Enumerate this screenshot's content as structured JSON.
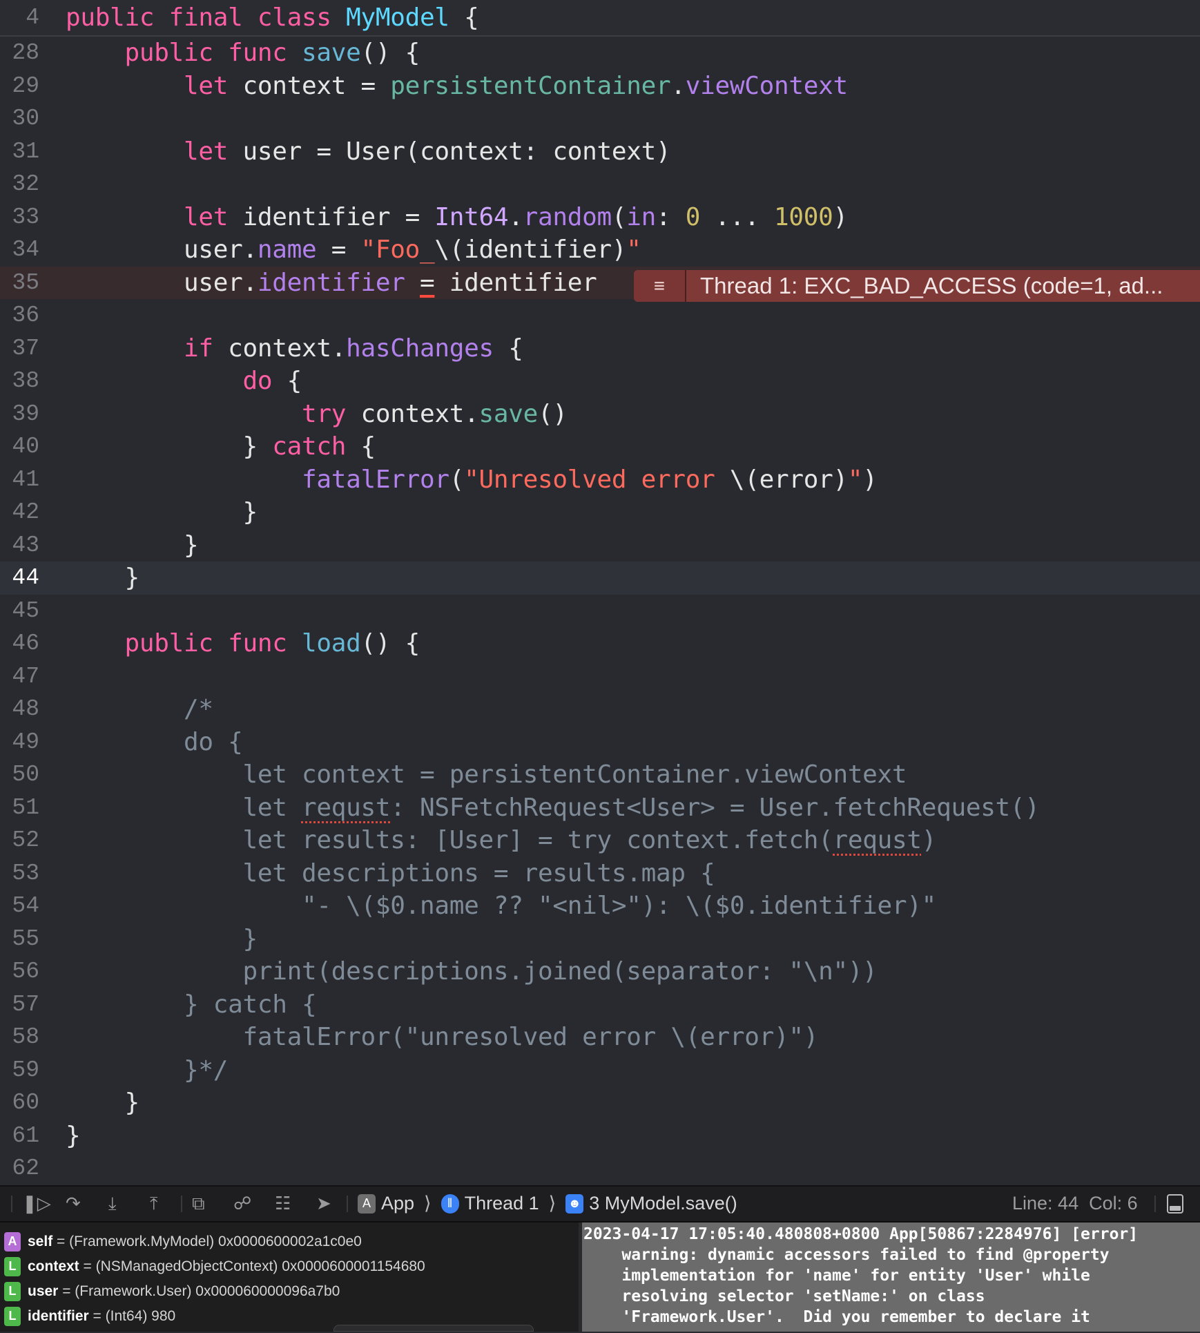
{
  "editor": {
    "sticky_header": {
      "number": "4",
      "tokens": [
        [
          "public",
          "kw"
        ],
        [
          " ",
          "pl"
        ],
        [
          "final",
          "kw"
        ],
        [
          " ",
          "pl"
        ],
        [
          "class",
          "kw"
        ],
        [
          " ",
          "pl"
        ],
        [
          "MyModel",
          "decl"
        ],
        [
          " {",
          "pl"
        ]
      ]
    },
    "lines": [
      {
        "number": "28",
        "tokens": [
          [
            "    ",
            "pl"
          ],
          [
            "public",
            "kw"
          ],
          [
            " ",
            "pl"
          ],
          [
            "func",
            "kw"
          ],
          [
            " ",
            "pl"
          ],
          [
            "save",
            "fn"
          ],
          [
            "() {",
            "pl"
          ]
        ]
      },
      {
        "number": "29",
        "tokens": [
          [
            "        ",
            "pl"
          ],
          [
            "let",
            "kw"
          ],
          [
            " context = ",
            "pl"
          ],
          [
            "persistentContainer",
            "proj"
          ],
          [
            ".",
            "pl"
          ],
          [
            "viewContext",
            "prop"
          ]
        ]
      },
      {
        "number": "30",
        "tokens": []
      },
      {
        "number": "31",
        "tokens": [
          [
            "        ",
            "pl"
          ],
          [
            "let",
            "kw"
          ],
          [
            " user = User(context: context)",
            "pl"
          ]
        ]
      },
      {
        "number": "32",
        "tokens": []
      },
      {
        "number": "33",
        "tokens": [
          [
            "        ",
            "pl"
          ],
          [
            "let",
            "kw"
          ],
          [
            " identifier = ",
            "pl"
          ],
          [
            "Int64",
            "type"
          ],
          [
            ".",
            "pl"
          ],
          [
            "random",
            "prop"
          ],
          [
            "(",
            "pl"
          ],
          [
            "in",
            "prop"
          ],
          [
            ": ",
            "pl"
          ],
          [
            "0",
            "num"
          ],
          [
            " ... ",
            "pl"
          ],
          [
            "1000",
            "num"
          ],
          [
            ")",
            "pl"
          ]
        ]
      },
      {
        "number": "34",
        "tokens": [
          [
            "        user.",
            "pl"
          ],
          [
            "name",
            "prop"
          ],
          [
            " = ",
            "pl"
          ],
          [
            "\"Foo_",
            "str"
          ],
          [
            "\\(identifier)",
            "pl"
          ],
          [
            "\"",
            "str"
          ]
        ]
      },
      {
        "number": "35",
        "error": true,
        "tokens": [
          [
            "        user.",
            "pl"
          ],
          [
            "identifier",
            "prop"
          ],
          [
            " ",
            "pl"
          ],
          [
            "=",
            "errop"
          ],
          [
            " identifier",
            "pl"
          ]
        ]
      },
      {
        "number": "36",
        "tokens": []
      },
      {
        "number": "37",
        "tokens": [
          [
            "        ",
            "pl"
          ],
          [
            "if",
            "kw"
          ],
          [
            " context.",
            "pl"
          ],
          [
            "hasChanges",
            "prop"
          ],
          [
            " {",
            "pl"
          ]
        ]
      },
      {
        "number": "38",
        "tokens": [
          [
            "            ",
            "pl"
          ],
          [
            "do",
            "kw"
          ],
          [
            " {",
            "pl"
          ]
        ]
      },
      {
        "number": "39",
        "tokens": [
          [
            "                ",
            "pl"
          ],
          [
            "try",
            "kw"
          ],
          [
            " context.",
            "pl"
          ],
          [
            "save",
            "proj"
          ],
          [
            "()",
            "pl"
          ]
        ]
      },
      {
        "number": "40",
        "tokens": [
          [
            "            } ",
            "pl"
          ],
          [
            "catch",
            "kw"
          ],
          [
            " {",
            "pl"
          ]
        ]
      },
      {
        "number": "41",
        "tokens": [
          [
            "                ",
            "pl"
          ],
          [
            "fatalError",
            "prop"
          ],
          [
            "(",
            "pl"
          ],
          [
            "\"Unresolved error ",
            "str"
          ],
          [
            "\\(error)",
            "pl"
          ],
          [
            "\"",
            "str"
          ],
          [
            ")",
            "pl"
          ]
        ]
      },
      {
        "number": "42",
        "tokens": [
          [
            "            }",
            "pl"
          ]
        ]
      },
      {
        "number": "43",
        "tokens": [
          [
            "        }",
            "pl"
          ]
        ]
      },
      {
        "number": "44",
        "current": true,
        "tokens": [
          [
            "    }",
            "pl"
          ]
        ]
      },
      {
        "number": "45",
        "tokens": []
      },
      {
        "number": "46",
        "tokens": [
          [
            "    ",
            "pl"
          ],
          [
            "public",
            "kw"
          ],
          [
            " ",
            "pl"
          ],
          [
            "func",
            "kw"
          ],
          [
            " ",
            "pl"
          ],
          [
            "load",
            "fn"
          ],
          [
            "() {",
            "pl"
          ]
        ]
      },
      {
        "number": "47",
        "tokens": []
      },
      {
        "number": "48",
        "tokens": [
          [
            "        /*",
            "cm"
          ]
        ]
      },
      {
        "number": "49",
        "tokens": [
          [
            "        do {",
            "cm"
          ]
        ]
      },
      {
        "number": "50",
        "tokens": [
          [
            "            let context = persistentContainer.viewContext",
            "cm"
          ]
        ]
      },
      {
        "number": "51",
        "tokens": [
          [
            "            let ",
            "cm"
          ],
          [
            "requst",
            "cm sq"
          ],
          [
            ": NSFetchRequest<User> = User.fetchRequest()",
            "cm"
          ]
        ]
      },
      {
        "number": "52",
        "tokens": [
          [
            "            let results: [User] = try context.fetch(",
            "cm"
          ],
          [
            "requst",
            "cm sq"
          ],
          [
            ")",
            "cm"
          ]
        ]
      },
      {
        "number": "53",
        "tokens": [
          [
            "            let descriptions = results.map {",
            "cm"
          ]
        ]
      },
      {
        "number": "54",
        "tokens": [
          [
            "                \"- \\($0.name ?? \"<nil>\"): \\($0.identifier)\"",
            "cm"
          ]
        ]
      },
      {
        "number": "55",
        "tokens": [
          [
            "            }",
            "cm"
          ]
        ]
      },
      {
        "number": "56",
        "tokens": [
          [
            "            print(descriptions.joined(separator: \"\\n\"))",
            "cm"
          ]
        ]
      },
      {
        "number": "57",
        "tokens": [
          [
            "        } catch {",
            "cm"
          ]
        ]
      },
      {
        "number": "58",
        "tokens": [
          [
            "            fatalError(\"unresolved error \\(error)\")",
            "cm"
          ]
        ]
      },
      {
        "number": "59",
        "tokens": [
          [
            "        }*/",
            "cm"
          ]
        ]
      },
      {
        "number": "60",
        "tokens": [
          [
            "    }",
            "pl"
          ]
        ]
      },
      {
        "number": "61",
        "tokens": [
          [
            "}",
            "pl"
          ]
        ]
      },
      {
        "number": "62",
        "tokens": []
      }
    ],
    "error_banner": {
      "icon": "list-icon",
      "message": "Thread 1: EXC_BAD_ACCESS (code=1, ad..."
    }
  },
  "toolbar": {
    "breadcrumb": [
      {
        "label": "App",
        "icon": "app-icon"
      },
      {
        "label": "Thread 1",
        "icon": "thread-icon"
      },
      {
        "label": "3 MyModel.save()",
        "icon": "user-frame-icon"
      }
    ],
    "line": "Line: 44",
    "col": "Col: 6"
  },
  "variables": [
    {
      "badge": "A",
      "badge_color": "#b46ed6",
      "name": "self",
      "eq": " = ",
      "value": "(Framework.MyModel) 0x0000600002a1c0e0"
    },
    {
      "badge": "L",
      "badge_color": "#4fb84a",
      "name": "context",
      "eq": " = ",
      "value": "(NSManagedObjectContext) 0x0000600001154680"
    },
    {
      "badge": "L",
      "badge_color": "#4fb84a",
      "name": "user",
      "eq": " = ",
      "value": "(Framework.User) 0x000060000096a7b0"
    },
    {
      "badge": "L",
      "badge_color": "#4fb84a",
      "name": "identifier",
      "eq": " = ",
      "value": "(Int64) 980"
    }
  ],
  "console": {
    "lines": [
      "2023-04-17 17:05:40.480808+0800 App[50867:2284976] [error]",
      "    warning: dynamic accessors failed to find @property",
      "    implementation for 'name' for entity 'User' while",
      "    resolving selector 'setName:' on class",
      "    'Framework.User'.  Did you remember to declare it"
    ]
  }
}
